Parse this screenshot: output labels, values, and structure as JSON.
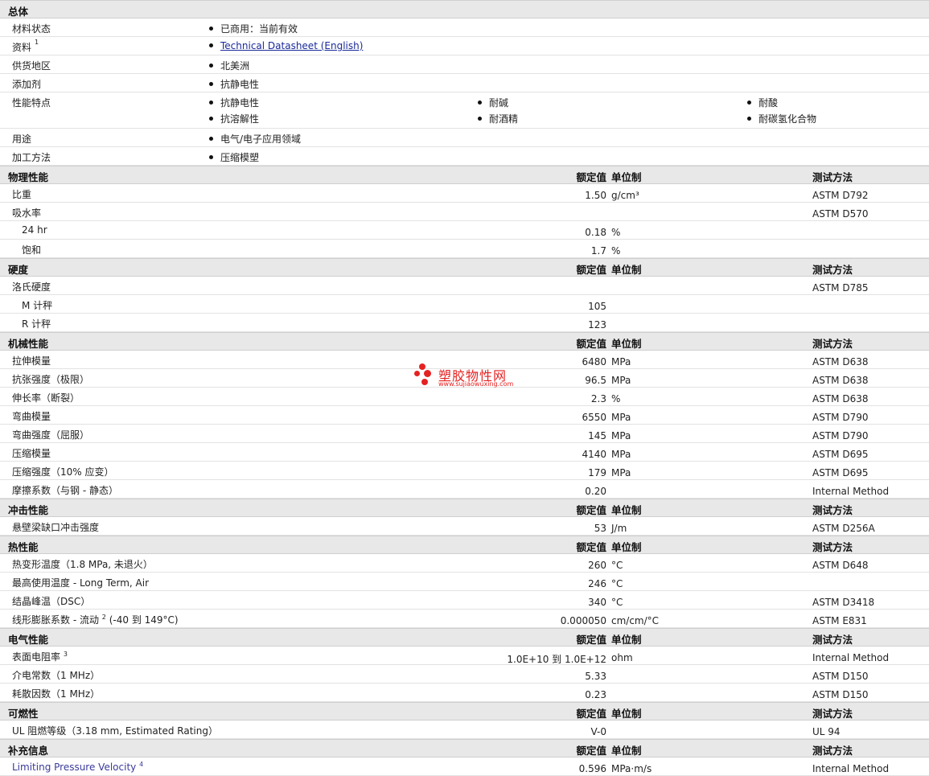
{
  "general": {
    "title": "总体",
    "rows": [
      {
        "label": "材料状态",
        "items": [
          "已商用：当前有效"
        ]
      },
      {
        "label": "资料",
        "sup": "1",
        "items": [
          "Technical Datasheet (English)"
        ],
        "link": true
      },
      {
        "label": "供货地区",
        "items": [
          "北美洲"
        ]
      },
      {
        "label": "添加剂",
        "items": [
          "抗静电性"
        ]
      },
      {
        "label": "性能特点",
        "items": [
          "抗静电性",
          "耐碱",
          "耐酸",
          "抗溶解性",
          "耐酒精",
          "耐碳氢化合物"
        ]
      },
      {
        "label": "用途",
        "items": [
          "电气/电子应用领域"
        ]
      },
      {
        "label": "加工方法",
        "items": [
          "压缩模塑"
        ]
      }
    ]
  },
  "header_cols": {
    "value": "额定值",
    "unit": "单位制",
    "method": "测试方法"
  },
  "sections": [
    {
      "title": "物理性能",
      "rows": [
        {
          "label": "比重",
          "value": "1.50",
          "unit": "g/cm³",
          "method": "ASTM D792"
        },
        {
          "label": "吸水率",
          "value": "",
          "unit": "",
          "method": "ASTM D570"
        },
        {
          "label": "24 hr",
          "sub": true,
          "value": "0.18",
          "unit": "%",
          "method": ""
        },
        {
          "label": "饱和",
          "sub": true,
          "value": "1.7",
          "unit": "%",
          "method": ""
        }
      ]
    },
    {
      "title": "硬度",
      "rows": [
        {
          "label": "洛氏硬度",
          "value": "",
          "unit": "",
          "method": "ASTM D785"
        },
        {
          "label": "M 计秤",
          "sub": true,
          "value": "105",
          "unit": "",
          "method": ""
        },
        {
          "label": "R 计秤",
          "sub": true,
          "value": "123",
          "unit": "",
          "method": ""
        }
      ]
    },
    {
      "title": "机械性能",
      "rows": [
        {
          "label": "拉伸模量",
          "value": "6480",
          "unit": "MPa",
          "method": "ASTM D638"
        },
        {
          "label": "抗张强度（极限）",
          "value": "96.5",
          "unit": "MPa",
          "method": "ASTM D638"
        },
        {
          "label": "伸长率（断裂）",
          "value": "2.3",
          "unit": "%",
          "method": "ASTM D638"
        },
        {
          "label": "弯曲模量",
          "value": "6550",
          "unit": "MPa",
          "method": "ASTM D790"
        },
        {
          "label": "弯曲强度（屈服）",
          "value": "145",
          "unit": "MPa",
          "method": "ASTM D790"
        },
        {
          "label": "压缩模量",
          "value": "4140",
          "unit": "MPa",
          "method": "ASTM D695"
        },
        {
          "label": "压缩强度（10% 应变）",
          "value": "179",
          "unit": "MPa",
          "method": "ASTM D695"
        },
        {
          "label": "摩擦系数（与钢 - 静态）",
          "value": "0.20",
          "unit": "",
          "method": "Internal Method"
        }
      ]
    },
    {
      "title": "冲击性能",
      "rows": [
        {
          "label": "悬壁梁缺口冲击强度",
          "value": "53",
          "unit": "J/m",
          "method": "ASTM D256A"
        }
      ]
    },
    {
      "title": "热性能",
      "rows": [
        {
          "label": "热变形温度（1.8 MPa, 未退火）",
          "value": "260",
          "unit": "°C",
          "method": "ASTM D648"
        },
        {
          "label": "最高使用温度 - Long Term, Air",
          "value": "246",
          "unit": "°C",
          "method": ""
        },
        {
          "label": "结晶峰温（DSC）",
          "value": "340",
          "unit": "°C",
          "method": "ASTM D3418"
        },
        {
          "label": "线形膨胀系数 - 流动",
          "sup": "2",
          "label2": "(-40 到 149°C)",
          "value": "0.000050",
          "unit": "cm/cm/°C",
          "method": "ASTM E831"
        }
      ]
    },
    {
      "title": "电气性能",
      "rows": [
        {
          "label": "表面电阻率",
          "sup": "3",
          "value": "1.0E+10 到 1.0E+12",
          "unit": "ohm",
          "method": "Internal Method"
        },
        {
          "label": "介电常数（1 MHz）",
          "value": "5.33",
          "unit": "",
          "method": "ASTM D150"
        },
        {
          "label": "耗散因数（1 MHz）",
          "value": "0.23",
          "unit": "",
          "method": "ASTM D150"
        }
      ]
    },
    {
      "title": "可燃性",
      "rows": [
        {
          "label": "UL 阻燃等级（3.18 mm, Estimated Rating）",
          "value": "V-0",
          "unit": "",
          "method": "UL 94"
        }
      ]
    },
    {
      "title": "补充信息",
      "rows": [
        {
          "label": "Limiting Pressure Velocity",
          "sup": "4",
          "value": "0.596",
          "unit": "MPa·m/s",
          "method": "Internal Method",
          "blue": true
        }
      ]
    }
  ],
  "watermark": {
    "name": "塑胶物性网",
    "url": "www.sujiaowuxing.com",
    "color": "#e52222"
  }
}
